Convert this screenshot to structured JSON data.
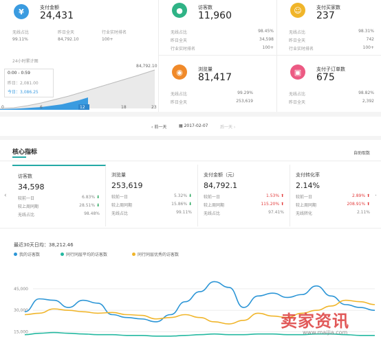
{
  "cards": {
    "payment": {
      "label": "支付金额",
      "value": "24,431",
      "rows": [
        [
          "无线占比",
          "99.11%"
        ]
      ],
      "extra": [
        "昨日全天",
        "84,792.10"
      ],
      "extra2": [
        "行业实时排名",
        "100+"
      ]
    },
    "visitors": {
      "label": "访客数",
      "value": "11,960",
      "rows": [
        [
          "无线占比",
          "98.45%"
        ],
        [
          "昨日全天",
          "34,598"
        ],
        [
          "行业实时排名",
          "100+"
        ]
      ]
    },
    "buyers": {
      "label": "支付买家数",
      "value": "237",
      "rows": [
        [
          "无线占比",
          "98.31%"
        ],
        [
          "昨日全天",
          "742"
        ],
        [
          "行业实时排名",
          "100+"
        ]
      ]
    },
    "pageviews": {
      "label": "浏览量",
      "value": "81,417",
      "rows": [
        [
          "无线占比",
          "99.29%"
        ],
        [
          "昨日全天",
          "253,619"
        ]
      ]
    },
    "orders": {
      "label": "支付子订单数",
      "value": "675",
      "rows": [
        [
          "无线占比",
          "98.82%"
        ],
        [
          "昨日全天",
          "2,392"
        ]
      ]
    }
  },
  "mini_chart": {
    "title": "24小时累计图",
    "peak": "84,792.10",
    "tooltip_time": "0:00 - 0:59",
    "tooltip_yesterday": "昨日：2,081.00",
    "tooltip_today": "今日：3,086.25",
    "x_labels": [
      "0",
      "6",
      "12",
      "18",
      "23"
    ]
  },
  "datebar": {
    "prev": "前一天",
    "date": "2017-02-07",
    "next": "后一天"
  },
  "core": {
    "title": "核心指标",
    "custom": "自助取数"
  },
  "kpis": [
    {
      "title": "访客数",
      "value": "34,598",
      "r1": [
        "较前一日",
        "6.83%",
        "down"
      ],
      "r2": [
        "较上周同期",
        "28.51%",
        "down"
      ],
      "r3": [
        "无线占比",
        "98.48%"
      ]
    },
    {
      "title": "浏览量",
      "value": "253,619",
      "r1": [
        "较前一日",
        "5.32%",
        "down"
      ],
      "r2": [
        "较上周同期",
        "15.86%",
        "down"
      ],
      "r3": [
        "无线占比",
        "99.11%"
      ]
    },
    {
      "title": "支付金额（元）",
      "value": "84,792.1",
      "r1": [
        "较前一日",
        "1.53%",
        "up"
      ],
      "r2": [
        "较上周同期",
        "115.20%",
        "up"
      ],
      "r3": [
        "无线占比",
        "97.41%"
      ]
    },
    {
      "title": "支付转化率",
      "value": "2.14%",
      "r1": [
        "较前一日",
        "2.89%",
        "up"
      ],
      "r2": [
        "较上周同期",
        "208.91%",
        "up"
      ],
      "r3": [
        "无线转化",
        "2.11%"
      ]
    }
  ],
  "trend": {
    "summary": "最近30天日均：38,212.46"
  },
  "chart_data": {
    "type": "line",
    "series": [
      {
        "name": "我的访客数",
        "color": "#2b95d6",
        "values": [
          29000,
          38000,
          37000,
          32000,
          37000,
          35000,
          27000,
          25000,
          24000,
          22000,
          27000,
          36000,
          43000,
          50000,
          46000,
          32000,
          40000,
          42000,
          39000,
          41000,
          47000,
          40000,
          34000,
          32000,
          30000
        ]
      },
      {
        "name": "同行同层平均的访客数",
        "color": "#23b8a0",
        "values": [
          13000,
          14000,
          14500,
          14000,
          13500,
          13000,
          13000,
          12500,
          12500,
          12000,
          12000,
          12500,
          13000,
          13500,
          13000,
          13000,
          13500,
          13500,
          13000,
          13000,
          13500,
          13500,
          13000,
          12500,
          12500
        ]
      },
      {
        "name": "同行同层优秀的访客数",
        "color": "#f0b52a",
        "values": [
          27000,
          28000,
          31000,
          30000,
          29000,
          28000,
          28500,
          27000,
          26500,
          24000,
          25000,
          27000,
          25000,
          22000,
          20500,
          23000,
          28000,
          26000,
          25000,
          28000,
          30000,
          33000,
          37000,
          36000,
          34000
        ]
      }
    ],
    "yticks": [
      "45,000",
      "30,000",
      "15,000"
    ],
    "ylim": [
      10000,
      55000
    ]
  },
  "watermark": {
    "brand": "卖家资讯",
    "url": "www.maijia.com"
  }
}
